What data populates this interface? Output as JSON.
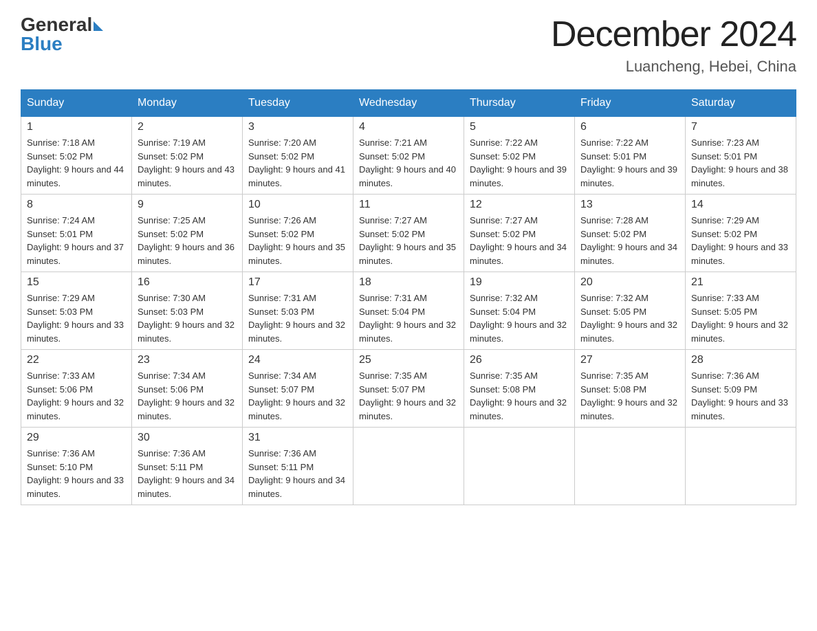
{
  "logo": {
    "general": "General",
    "blue": "Blue"
  },
  "header": {
    "month_year": "December 2024",
    "location": "Luancheng, Hebei, China"
  },
  "days_of_week": [
    "Sunday",
    "Monday",
    "Tuesday",
    "Wednesday",
    "Thursday",
    "Friday",
    "Saturday"
  ],
  "weeks": [
    [
      {
        "day": "1",
        "sunrise": "7:18 AM",
        "sunset": "5:02 PM",
        "daylight": "9 hours and 44 minutes."
      },
      {
        "day": "2",
        "sunrise": "7:19 AM",
        "sunset": "5:02 PM",
        "daylight": "9 hours and 43 minutes."
      },
      {
        "day": "3",
        "sunrise": "7:20 AM",
        "sunset": "5:02 PM",
        "daylight": "9 hours and 41 minutes."
      },
      {
        "day": "4",
        "sunrise": "7:21 AM",
        "sunset": "5:02 PM",
        "daylight": "9 hours and 40 minutes."
      },
      {
        "day": "5",
        "sunrise": "7:22 AM",
        "sunset": "5:02 PM",
        "daylight": "9 hours and 39 minutes."
      },
      {
        "day": "6",
        "sunrise": "7:22 AM",
        "sunset": "5:01 PM",
        "daylight": "9 hours and 39 minutes."
      },
      {
        "day": "7",
        "sunrise": "7:23 AM",
        "sunset": "5:01 PM",
        "daylight": "9 hours and 38 minutes."
      }
    ],
    [
      {
        "day": "8",
        "sunrise": "7:24 AM",
        "sunset": "5:01 PM",
        "daylight": "9 hours and 37 minutes."
      },
      {
        "day": "9",
        "sunrise": "7:25 AM",
        "sunset": "5:02 PM",
        "daylight": "9 hours and 36 minutes."
      },
      {
        "day": "10",
        "sunrise": "7:26 AM",
        "sunset": "5:02 PM",
        "daylight": "9 hours and 35 minutes."
      },
      {
        "day": "11",
        "sunrise": "7:27 AM",
        "sunset": "5:02 PM",
        "daylight": "9 hours and 35 minutes."
      },
      {
        "day": "12",
        "sunrise": "7:27 AM",
        "sunset": "5:02 PM",
        "daylight": "9 hours and 34 minutes."
      },
      {
        "day": "13",
        "sunrise": "7:28 AM",
        "sunset": "5:02 PM",
        "daylight": "9 hours and 34 minutes."
      },
      {
        "day": "14",
        "sunrise": "7:29 AM",
        "sunset": "5:02 PM",
        "daylight": "9 hours and 33 minutes."
      }
    ],
    [
      {
        "day": "15",
        "sunrise": "7:29 AM",
        "sunset": "5:03 PM",
        "daylight": "9 hours and 33 minutes."
      },
      {
        "day": "16",
        "sunrise": "7:30 AM",
        "sunset": "5:03 PM",
        "daylight": "9 hours and 32 minutes."
      },
      {
        "day": "17",
        "sunrise": "7:31 AM",
        "sunset": "5:03 PM",
        "daylight": "9 hours and 32 minutes."
      },
      {
        "day": "18",
        "sunrise": "7:31 AM",
        "sunset": "5:04 PM",
        "daylight": "9 hours and 32 minutes."
      },
      {
        "day": "19",
        "sunrise": "7:32 AM",
        "sunset": "5:04 PM",
        "daylight": "9 hours and 32 minutes."
      },
      {
        "day": "20",
        "sunrise": "7:32 AM",
        "sunset": "5:05 PM",
        "daylight": "9 hours and 32 minutes."
      },
      {
        "day": "21",
        "sunrise": "7:33 AM",
        "sunset": "5:05 PM",
        "daylight": "9 hours and 32 minutes."
      }
    ],
    [
      {
        "day": "22",
        "sunrise": "7:33 AM",
        "sunset": "5:06 PM",
        "daylight": "9 hours and 32 minutes."
      },
      {
        "day": "23",
        "sunrise": "7:34 AM",
        "sunset": "5:06 PM",
        "daylight": "9 hours and 32 minutes."
      },
      {
        "day": "24",
        "sunrise": "7:34 AM",
        "sunset": "5:07 PM",
        "daylight": "9 hours and 32 minutes."
      },
      {
        "day": "25",
        "sunrise": "7:35 AM",
        "sunset": "5:07 PM",
        "daylight": "9 hours and 32 minutes."
      },
      {
        "day": "26",
        "sunrise": "7:35 AM",
        "sunset": "5:08 PM",
        "daylight": "9 hours and 32 minutes."
      },
      {
        "day": "27",
        "sunrise": "7:35 AM",
        "sunset": "5:08 PM",
        "daylight": "9 hours and 32 minutes."
      },
      {
        "day": "28",
        "sunrise": "7:36 AM",
        "sunset": "5:09 PM",
        "daylight": "9 hours and 33 minutes."
      }
    ],
    [
      {
        "day": "29",
        "sunrise": "7:36 AM",
        "sunset": "5:10 PM",
        "daylight": "9 hours and 33 minutes."
      },
      {
        "day": "30",
        "sunrise": "7:36 AM",
        "sunset": "5:11 PM",
        "daylight": "9 hours and 34 minutes."
      },
      {
        "day": "31",
        "sunrise": "7:36 AM",
        "sunset": "5:11 PM",
        "daylight": "9 hours and 34 minutes."
      },
      null,
      null,
      null,
      null
    ]
  ]
}
